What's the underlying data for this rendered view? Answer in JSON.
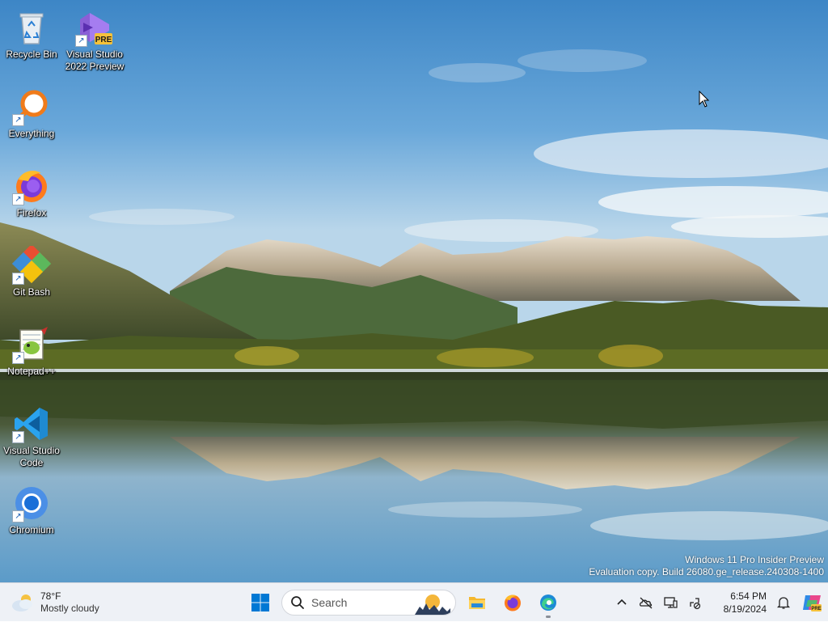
{
  "desktop": {
    "icons": [
      {
        "name": "recycle-bin",
        "label": "Recycle Bin",
        "icon": "recycle-bin-icon",
        "shortcut": false
      },
      {
        "name": "visual-studio-2022-preview",
        "label": "Visual Studio 2022 Preview",
        "icon": "visual-studio-icon",
        "badge": "PRE",
        "shortcut": true
      },
      {
        "name": "everything",
        "label": "Everything",
        "icon": "magnifier-icon",
        "shortcut": true
      },
      {
        "name": "firefox",
        "label": "Firefox",
        "icon": "firefox-icon",
        "shortcut": true
      },
      {
        "name": "git-bash",
        "label": "Git Bash",
        "icon": "git-bash-icon",
        "shortcut": true
      },
      {
        "name": "notepad-plus-plus",
        "label": "Notepad++",
        "icon": "notepad-plus-plus-icon",
        "shortcut": true
      },
      {
        "name": "visual-studio-code",
        "label": "Visual Studio Code",
        "icon": "vscode-icon",
        "shortcut": true
      },
      {
        "name": "chromium",
        "label": "Chromium",
        "icon": "chromium-icon",
        "shortcut": true
      }
    ],
    "watermark": {
      "line1": "Windows 11 Pro Insider Preview",
      "line2": "Evaluation copy. Build 26080.ge_release.240308-1400"
    },
    "shortcut_arrow": "↗"
  },
  "taskbar": {
    "weather": {
      "temp": "78°F",
      "condition": "Mostly cloudy",
      "icon": "cloud-sun-icon"
    },
    "search": {
      "placeholder": "Search"
    },
    "apps": [
      {
        "name": "start",
        "icon": "windows-logo-icon"
      },
      {
        "name": "file-explorer",
        "icon": "folder-icon"
      },
      {
        "name": "firefox",
        "icon": "firefox-icon"
      },
      {
        "name": "edge",
        "icon": "edge-icon",
        "running": true
      }
    ],
    "tray": {
      "icons": [
        "chevron-up-icon",
        "onedrive-offline-icon",
        "display-icon",
        "network-icon"
      ],
      "time": "6:54 PM",
      "date": "8/19/2024",
      "notification_icon": "bell-icon",
      "copilot_icon": "copilot-icon"
    }
  },
  "colors": {
    "accent": "#0067c0",
    "taskbar_bg": "#eef1f6"
  }
}
